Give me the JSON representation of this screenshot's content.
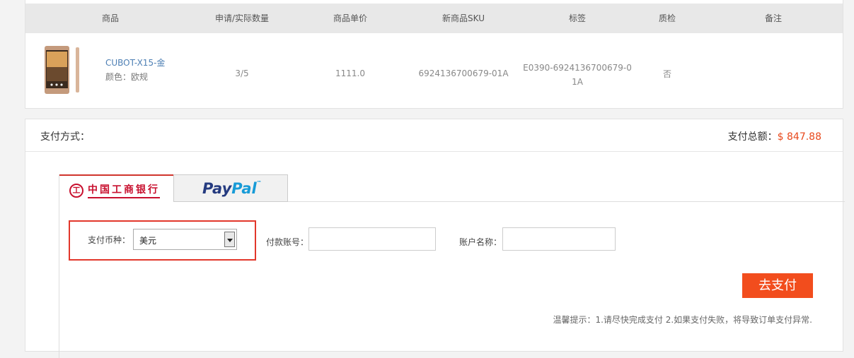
{
  "table": {
    "headers": {
      "product": "商品",
      "quantity": "申请/实际数量",
      "unit_price": "商品单价",
      "new_sku": "新商品SKU",
      "tag": "标签",
      "qc": "质检",
      "remark": "备注"
    },
    "row": {
      "product_name": "CUBOT-X15-金",
      "product_color": "颜色：欧规",
      "quantity": "3/5",
      "unit_price": "1111.0",
      "new_sku": "6924136700679-01A",
      "tag": "E0390-6924136700679-01A",
      "qc": "否",
      "remark": ""
    }
  },
  "payment": {
    "method_label": "支付方式：",
    "total_label": "支付总额：",
    "total_amount": "$ 847.88",
    "tabs": {
      "icbc_label": "中国工商银行",
      "icbc_logo_glyph": "工",
      "paypal_pay": "Pay",
      "paypal_pal": "Pal"
    },
    "currency_label": "支付币种：",
    "currency_value": "美元",
    "account_label": "付款账号：",
    "account_name_label": "账户名称：",
    "submit_label": "去支付",
    "tip": "温馨提示：1.请尽快完成支付 2.如果支付失败，将导致订单支付异常."
  },
  "colors": {
    "accent": "#f24d1d",
    "highlight": "#e2372b",
    "link": "#4d7fb4"
  }
}
